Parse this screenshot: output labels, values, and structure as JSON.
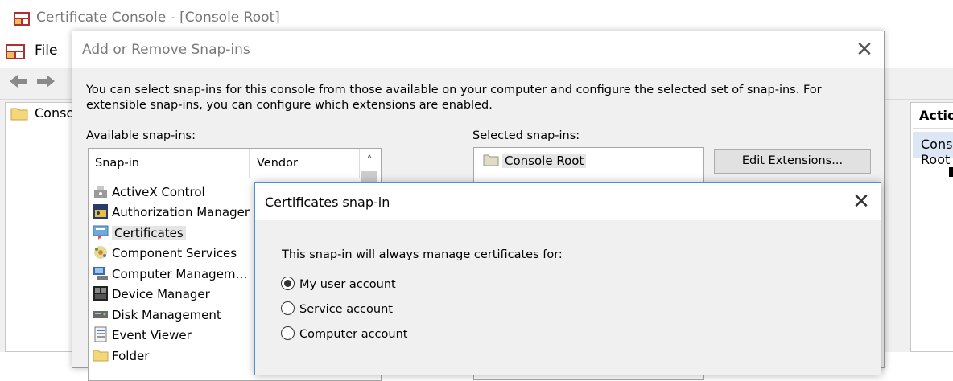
{
  "mmc": {
    "title": "Certificate Console - [Console Root]",
    "menu_file": "File",
    "tree_item": "Console Root",
    "actions_header": "Actions",
    "actions_sub": "Console Root"
  },
  "snapins_dialog": {
    "title": "Add or Remove Snap-ins",
    "close_glyph": "✕",
    "description": "You can select snap-ins for this console from those available on your computer and configure the selected set of snap-ins. For extensible snap-ins, you can configure which extensions are enabled.",
    "available_label": "Available snap-ins:",
    "columns": {
      "snapin": "Snap-in",
      "vendor": "Vendor"
    },
    "scroll_up_glyph": "˄",
    "available": [
      {
        "name": "ActiveX Control",
        "icon": "activex-icon"
      },
      {
        "name": "Authorization Manager",
        "icon": "authorization-manager-icon"
      },
      {
        "name": "Certificates",
        "icon": "certificates-icon",
        "selected": true
      },
      {
        "name": "Component Services",
        "icon": "component-services-icon"
      },
      {
        "name": "Computer Managem…",
        "icon": "computer-management-icon"
      },
      {
        "name": "Device Manager",
        "icon": "device-manager-icon"
      },
      {
        "name": "Disk Management",
        "icon": "disk-management-icon"
      },
      {
        "name": "Event Viewer",
        "icon": "event-viewer-icon"
      },
      {
        "name": "Folder",
        "icon": "folder-icon"
      }
    ],
    "selected_label": "Selected snap-ins:",
    "selected": [
      {
        "name": "Console Root",
        "icon": "folder-icon"
      }
    ],
    "edit_extensions_button": "Edit Extensions..."
  },
  "cert_dialog": {
    "title": "Certificates snap-in",
    "close_glyph": "✕",
    "prompt": "This snap-in will always manage certificates for:",
    "options": [
      {
        "label": "My user account",
        "checked": true
      },
      {
        "label": "Service account",
        "checked": false
      },
      {
        "label": "Computer account",
        "checked": false
      }
    ]
  }
}
